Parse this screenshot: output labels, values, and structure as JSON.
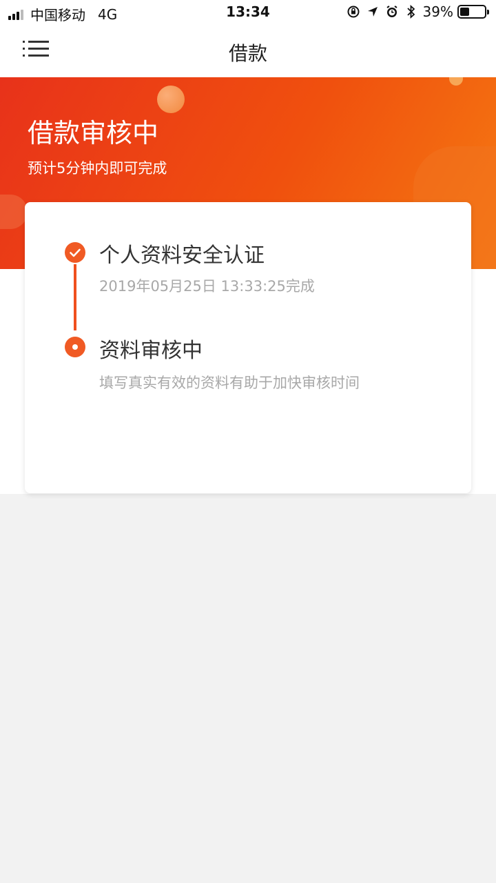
{
  "status_bar": {
    "carrier": "中国移动",
    "network": "4G",
    "time": "13:34",
    "battery_percent": "39%",
    "battery_level": 0.39
  },
  "nav": {
    "title": "借款",
    "menu_icon": "menu-icon"
  },
  "banner": {
    "title": "借款审核中",
    "subtitle": "预计5分钟内即可完成"
  },
  "steps": [
    {
      "title": "个人资料安全认证",
      "desc": "2019年05月25日 13:33:25完成",
      "state": "done",
      "icon": "check-icon"
    },
    {
      "title": "资料审核中",
      "desc": "填写真实有效的资料有助于加快审核时间",
      "state": "current",
      "icon": "current-dot-icon"
    }
  ],
  "colors": {
    "accent": "#f05a24",
    "banner_start": "#e8321a",
    "banner_end": "#f57a12"
  }
}
